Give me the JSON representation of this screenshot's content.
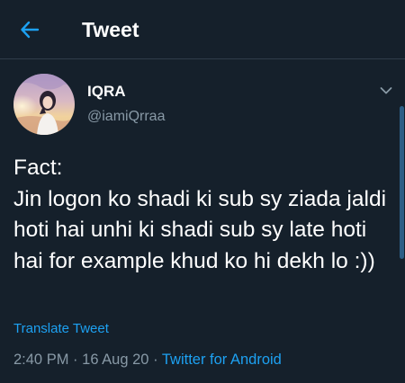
{
  "header": {
    "title": "Tweet",
    "back_icon": "arrow-left-icon",
    "accent": "#1da1f2"
  },
  "author": {
    "display_name": "IQRA",
    "handle": "@iamiQrraa"
  },
  "tweet": {
    "text": "Fact:\nJin logon ko shadi ki sub sy ziada jaldi hoti hai unhi ki shadi sub sy late hoti hai for example khud ko hi dekh lo :))",
    "translate_label": "Translate Tweet",
    "time": "2:40 PM",
    "date": "16 Aug 20",
    "separator": "·",
    "source": "Twitter for Android"
  },
  "colors": {
    "background": "#15202b",
    "secondary_text": "#8899a6",
    "link": "#1da1f2"
  }
}
